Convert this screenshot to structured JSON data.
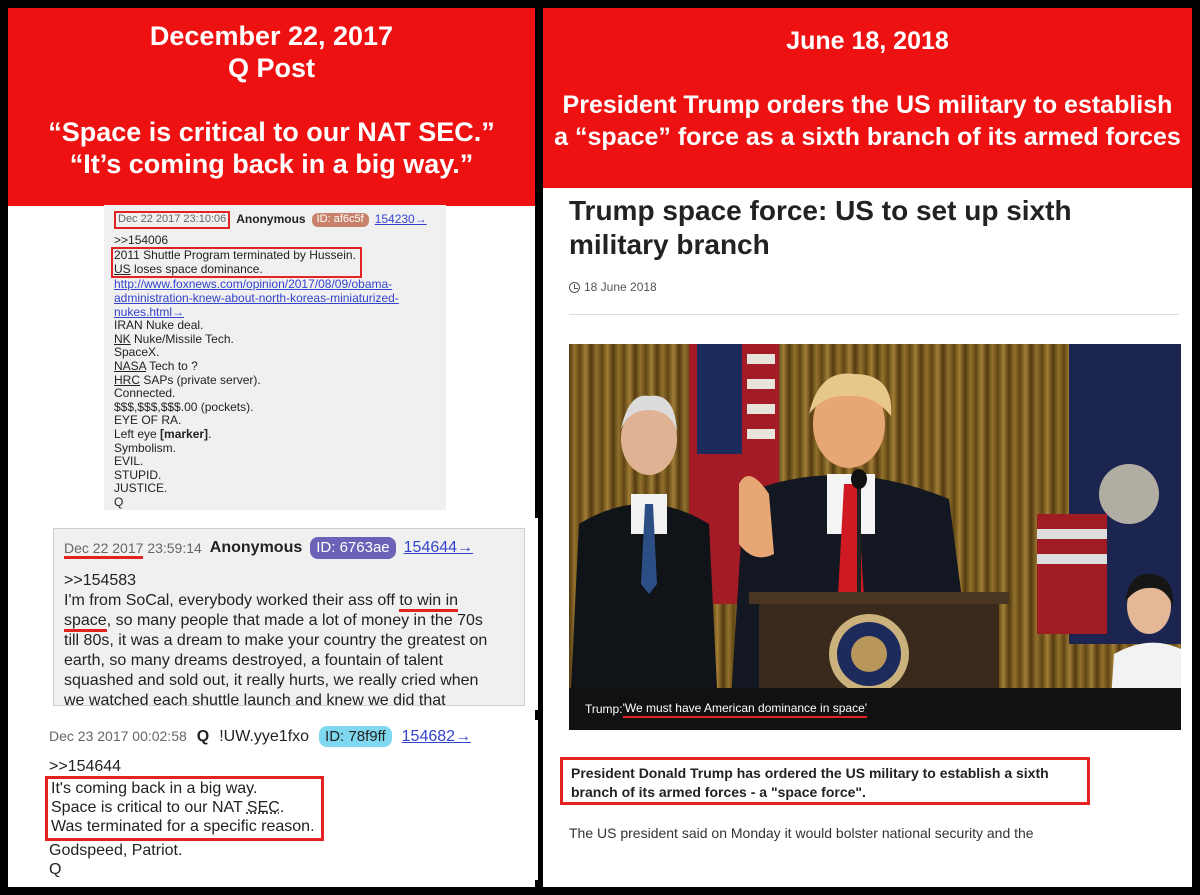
{
  "left": {
    "banner": {
      "line1": "December 22, 2017",
      "line2": "Q Post",
      "line3": "“Space is critical to our NAT SEC.”",
      "line4": "“It’s coming back in a big way.”"
    },
    "post1": {
      "date": "Dec 22 2017 23:10:06",
      "author": "Anonymous",
      "id": "ID: af6c5f",
      "num": "154230→",
      "reply": ">>154006",
      "boxed1": "2011 Shuttle Program terminated by Hussein.",
      "boxed2_u": "US",
      "boxed2_rest": " loses space dominance.",
      "url1": "http://www.foxnews.com/opinion/2017/08/09/obama-",
      "url2": "administration-knew-about-north-koreas-miniaturized-",
      "url3": "nukes.html→",
      "l1": "IRAN Nuke deal.",
      "l2u": "NK",
      "l2": " Nuke/Missile Tech.",
      "l3": "SpaceX.",
      "l4u": "NASA",
      "l4": " Tech to ?",
      "l5u": "HRC",
      "l5": " SAPs (private server).",
      "l6": "Connected.",
      "l7": "$$$,$$$,$$$.00 (pockets).",
      "l8": "EYE OF RA.",
      "l9a": "Left eye ",
      "l9b": "[marker]",
      "l9c": ".",
      "l10": "Symbolism.",
      "l11": "EVIL.",
      "l12": "STUPID.",
      "l13": "JUSTICE.",
      "l14": "Q"
    },
    "post2": {
      "date_a": "Dec 22 2017",
      "date_b": " 23:59:14",
      "author": "Anonymous",
      "id": "ID: 6763ae",
      "num": "154644→",
      "reply": ">>154583",
      "t1a": "I'm from SoCal, everybody worked their ass off ",
      "t1b": "to win in",
      "t2a": "space",
      "t2b": ", so many people that made a lot of money in the 70s",
      "t3": "till 80s, it was a dream to make your country the greatest on",
      "t4": "earth, so many dreams destroyed, a fountain of talent",
      "t5": "squashed and sold out, it really hurts, we really cried when",
      "t6": "we watched each shuttle launch and knew we did that"
    },
    "post3": {
      "date": "Dec 23 2017 00:02:58",
      "q": "Q",
      "trip": "!UW.yye1fxo",
      "id": "ID: 78f9ff",
      "num": "154682→",
      "reply": ">>154644",
      "b1": "It's coming back in a big way.",
      "b2a": "Space is critical to our NAT ",
      "b2b": "SEC",
      "b2c": ".",
      "b3": "Was terminated for a specific reason.",
      "l4": "Godspeed, Patriot.",
      "l5": "Q"
    }
  },
  "right": {
    "banner": {
      "line1": "June 18, 2018",
      "line2": "President Trump orders the US military to establish",
      "line3": "a “space” force as a sixth branch of its armed forces"
    },
    "article": {
      "title": "Trump space force: US to set up sixth military branch",
      "date": "18 June 2018",
      "caption_prefix": "Trump: ",
      "caption_quote": "'We must have American dominance in space'",
      "summary": "President Donald Trump has ordered the US military to establish a sixth branch of its armed forces - a \"space force\".",
      "body": "The US president said on Monday it would bolster national security and the"
    }
  },
  "colors": {
    "banner_red": "#ee1111",
    "highlight_red": "#e52222",
    "link_blue": "#3344cc"
  }
}
